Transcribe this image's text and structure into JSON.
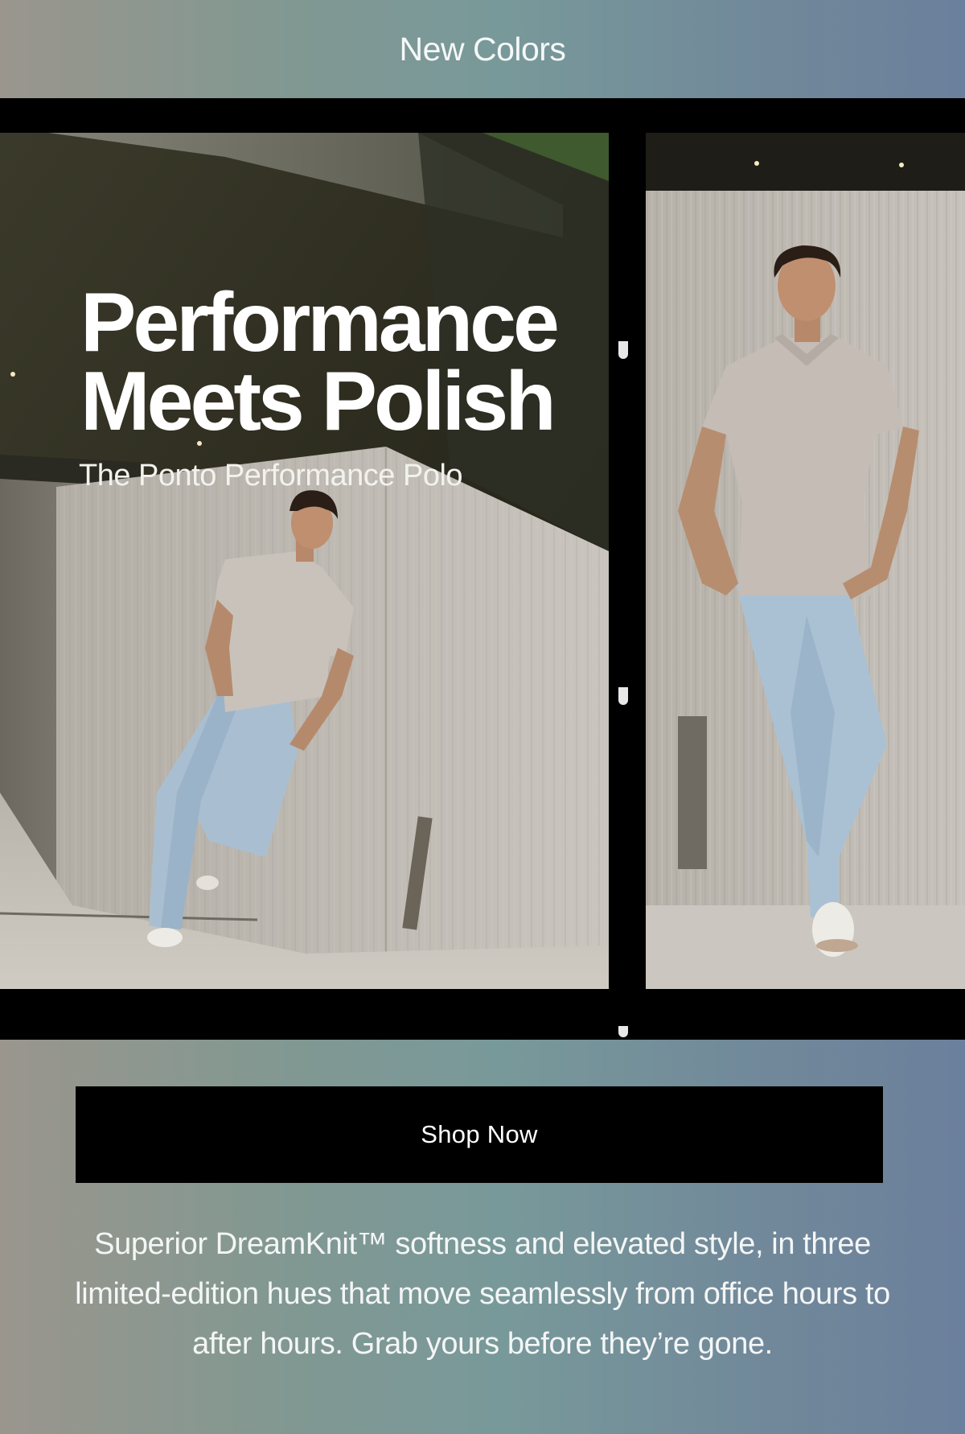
{
  "banner": {
    "label": "New Colors"
  },
  "hero": {
    "title_line1": "Performance",
    "title_line2": "Meets Polish",
    "subtitle": "The Ponto Performance Polo"
  },
  "images": {
    "left": "man-leaning-on-concrete-wall-wide",
    "right": "man-leaning-on-concrete-wall-closeup"
  },
  "cta": {
    "label": "Shop Now"
  },
  "body": {
    "copy": "Superior DreamKnit™ softness and elevated style, in three limited-edition hues that move seamlessly from office hours to after hours. Grab yours before they’re gone."
  },
  "colors": {
    "gradient_left": "#9a968d",
    "gradient_mid": "#78999a",
    "gradient_right": "#6b809c",
    "button_bg": "#000000",
    "text": "#ffffff"
  }
}
